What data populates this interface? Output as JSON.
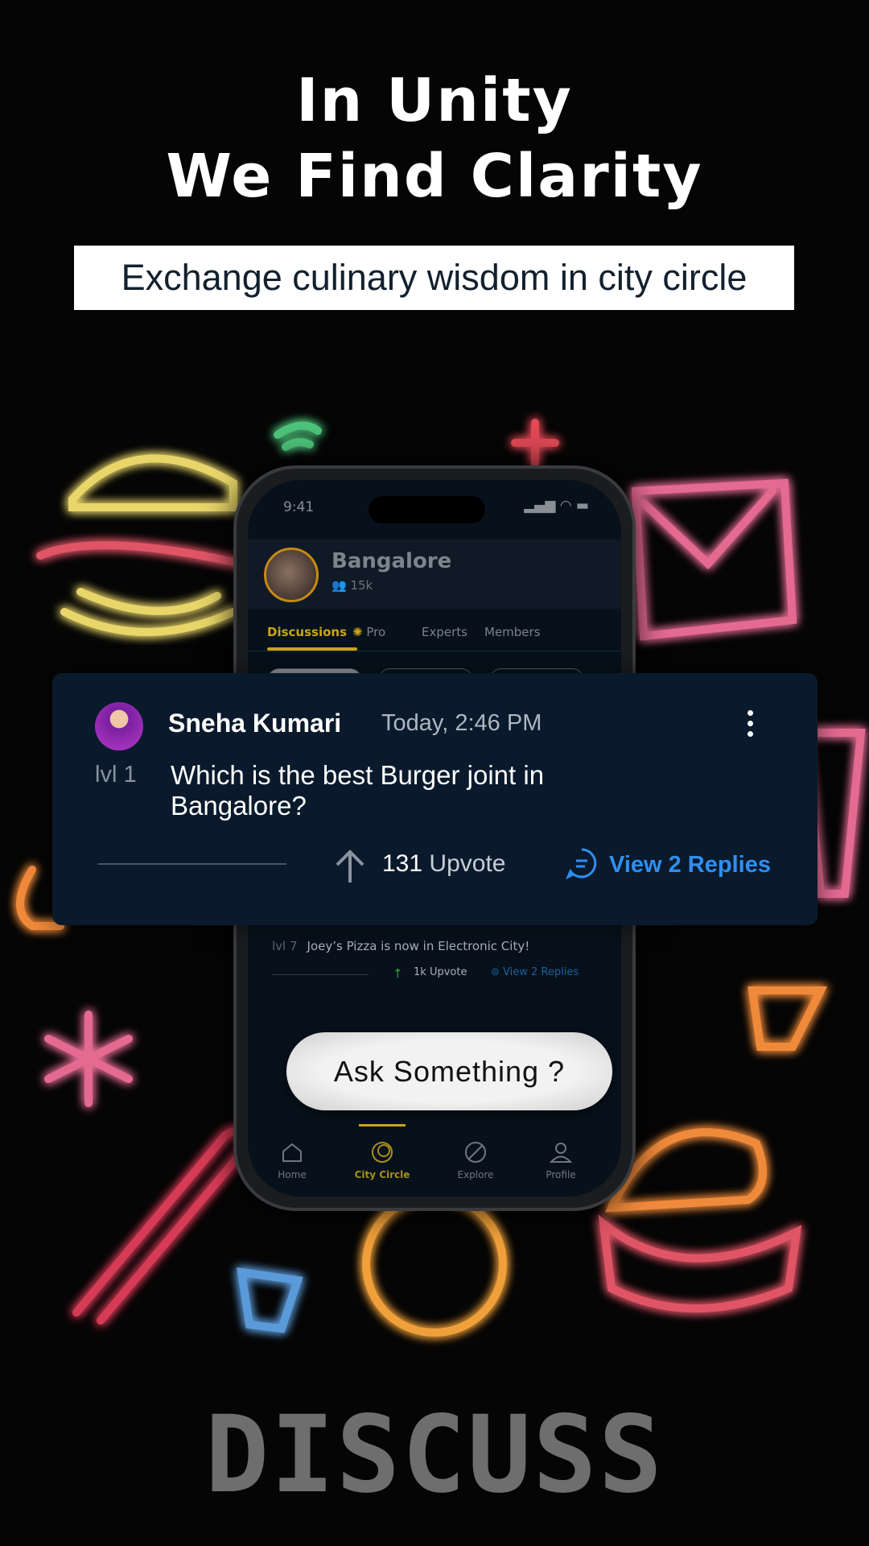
{
  "headline": {
    "line1": "In Unity",
    "line2": "We Find Clarity"
  },
  "subtitle": "Exchange culinary wisdom in city circle",
  "phone": {
    "status_time": "9:41",
    "city": {
      "name": "Bangalore",
      "members": "15k"
    },
    "tabs": [
      {
        "label": "Discussions",
        "active": true
      },
      {
        "label": "Pro",
        "icon": "pro-badge-icon"
      },
      {
        "label": "Experts"
      },
      {
        "label": "Members"
      }
    ],
    "post2": {
      "level": "lvl 7",
      "text": "Joey’s Pizza is now in Electronic City!",
      "upvotes": "1k",
      "upvote_label": "Upvote",
      "replies": "View 2 Replies"
    },
    "ask_button": "Ask Something ?",
    "nav": [
      {
        "label": "Home",
        "icon": "home-icon"
      },
      {
        "label": "City Circle",
        "icon": "city-circle-icon",
        "active": true
      },
      {
        "label": "Explore",
        "icon": "explore-icon"
      },
      {
        "label": "Profile",
        "icon": "profile-icon"
      }
    ]
  },
  "card": {
    "user": "Sneha Kumari",
    "time": "Today, 2:46 PM",
    "level": "lvl 1",
    "question": "Which is the best Burger joint in Bangalore?",
    "upvotes": "131",
    "upvote_label": "Upvote",
    "replies": "View 2 Replies"
  },
  "footer_word": "DISCUSS",
  "colors": {
    "accent_gold": "#c9a618",
    "link_blue": "#2f8ff0",
    "card_bg": "#0a1a2c",
    "upvote_green": "#2f9e44"
  }
}
